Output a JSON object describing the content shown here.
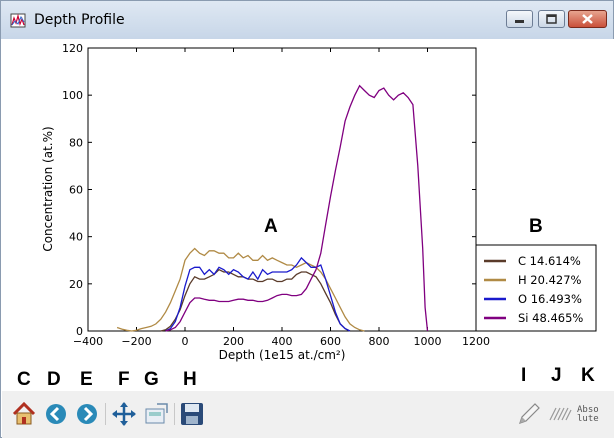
{
  "window": {
    "title": "Depth Profile"
  },
  "chart_data": {
    "type": "line",
    "xlabel": "Depth (1e15 at./cm²)",
    "ylabel": "Concentration (at.%)",
    "xlim": [
      -400,
      1200
    ],
    "ylim": [
      0,
      120
    ],
    "xticks": [
      "−400",
      "−200",
      "0",
      "200",
      "400",
      "600",
      "800",
      "1000",
      "1200"
    ],
    "yticks": [
      "0",
      "20",
      "40",
      "60",
      "80",
      "100",
      "120"
    ],
    "legend_position": "right",
    "series": [
      {
        "name": "C 14.614%",
        "color": "#5a3b2a",
        "x": [
          -100,
          -80,
          -60,
          -40,
          -20,
          0,
          20,
          40,
          60,
          80,
          100,
          120,
          140,
          160,
          180,
          200,
          220,
          240,
          260,
          280,
          300,
          320,
          340,
          360,
          380,
          400,
          420,
          440,
          460,
          480,
          500,
          520,
          540,
          560,
          580,
          600,
          620,
          640,
          660,
          680
        ],
        "y": [
          0,
          0.5,
          2,
          5,
          9,
          15,
          20,
          23,
          22,
          22,
          23,
          24,
          26,
          25,
          25,
          24,
          23,
          23,
          22,
          22,
          21,
          21,
          22,
          22,
          21,
          21,
          22,
          22,
          24,
          25,
          25,
          24,
          23,
          20,
          16,
          12,
          7,
          3,
          1,
          0
        ]
      },
      {
        "name": "H 20.427%",
        "color": "#b08a45",
        "x": [
          -280,
          -260,
          -240,
          -220,
          -200,
          -180,
          -160,
          -140,
          -120,
          -100,
          -80,
          -60,
          -40,
          -20,
          0,
          20,
          40,
          60,
          80,
          100,
          120,
          140,
          160,
          180,
          200,
          220,
          240,
          260,
          280,
          300,
          320,
          340,
          360,
          380,
          400,
          420,
          440,
          460,
          480,
          500,
          520,
          540,
          560,
          580,
          600,
          620,
          640,
          660,
          680,
          700,
          720,
          740
        ],
        "y": [
          1.5,
          0.8,
          0.3,
          0,
          0.3,
          1,
          1.5,
          2,
          3,
          5,
          8,
          12,
          17,
          22,
          30,
          33,
          35,
          33,
          32,
          34,
          34,
          33,
          33,
          31,
          31,
          33,
          31,
          32,
          30,
          30,
          32,
          30,
          31,
          30,
          29,
          28,
          28,
          27,
          28,
          29,
          28,
          27,
          25,
          22,
          18,
          14,
          10,
          6,
          3,
          1.5,
          0.5,
          0
        ]
      },
      {
        "name": "O 16.493%",
        "color": "#1a1acc",
        "x": [
          -80,
          -60,
          -40,
          -20,
          0,
          20,
          40,
          60,
          80,
          100,
          120,
          140,
          160,
          180,
          200,
          220,
          240,
          260,
          280,
          300,
          320,
          340,
          360,
          380,
          400,
          420,
          440,
          460,
          480,
          500,
          520,
          540,
          560,
          580,
          600,
          620,
          640,
          660,
          680
        ],
        "y": [
          0,
          1,
          4,
          10,
          19,
          26,
          27,
          27,
          24,
          26,
          24,
          27,
          26,
          24,
          26,
          25,
          23,
          22,
          25,
          22,
          26,
          24,
          25,
          25,
          25,
          25,
          26,
          28,
          31,
          29,
          27,
          27,
          28,
          22,
          15,
          8,
          3,
          1,
          0
        ]
      },
      {
        "name": "Si 48.465%",
        "color": "#800080",
        "x": [
          -80,
          -60,
          -40,
          -20,
          0,
          20,
          40,
          60,
          80,
          100,
          120,
          140,
          160,
          180,
          200,
          220,
          240,
          260,
          280,
          300,
          320,
          340,
          360,
          380,
          400,
          420,
          440,
          460,
          480,
          500,
          520,
          540,
          560,
          580,
          600,
          620,
          640,
          660,
          680,
          700,
          720,
          740,
          760,
          780,
          800,
          820,
          840,
          860,
          880,
          900,
          920,
          940,
          960,
          980,
          990,
          1000
        ],
        "y": [
          0,
          0.5,
          1.5,
          4,
          8,
          12,
          14,
          14,
          13.5,
          13,
          13,
          12.5,
          12.5,
          12.5,
          13,
          13.5,
          13.5,
          13,
          13,
          12.5,
          12.5,
          13,
          14,
          15,
          15.5,
          15.5,
          15,
          15,
          15.5,
          18,
          22,
          26,
          33,
          45,
          57,
          68,
          78,
          89,
          95,
          100,
          104,
          102,
          100,
          99,
          102,
          103,
          100,
          98,
          100,
          101,
          99,
          96,
          70,
          35,
          10,
          0
        ]
      }
    ]
  },
  "overlay_labels": {
    "a": "A",
    "b": "B",
    "c": "C",
    "d": "D",
    "e": "E",
    "f": "F",
    "g": "G",
    "h": "H",
    "i": "I",
    "j": "J",
    "k": "K"
  },
  "toolbar": {
    "icons": [
      "home-icon",
      "back-icon",
      "forward-icon",
      "pan-icon",
      "subplots-icon",
      "save-icon",
      "pencil-icon",
      "hatch-icon"
    ],
    "absolute_label_line1": "Abso",
    "absolute_label_line2": "lute"
  }
}
